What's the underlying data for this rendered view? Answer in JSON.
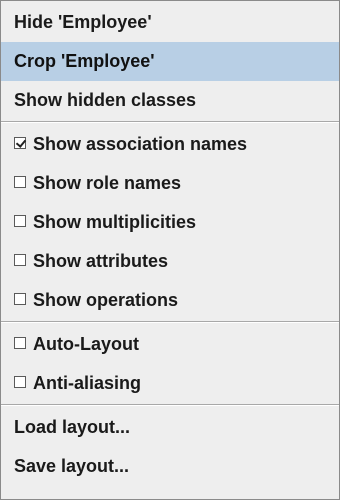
{
  "menu": {
    "group1": [
      {
        "label": "Hide 'Employee'"
      },
      {
        "label": "Crop 'Employee'"
      },
      {
        "label": "Show hidden classes"
      }
    ],
    "group2": [
      {
        "label": "Show association names",
        "checked": true
      },
      {
        "label": "Show role names",
        "checked": false
      },
      {
        "label": "Show multiplicities",
        "checked": false
      },
      {
        "label": "Show attributes",
        "checked": false
      },
      {
        "label": "Show operations",
        "checked": false
      }
    ],
    "group3": [
      {
        "label": "Auto-Layout",
        "checked": false
      },
      {
        "label": "Anti-aliasing",
        "checked": false
      }
    ],
    "group4": [
      {
        "label": "Load layout..."
      },
      {
        "label": "Save layout..."
      }
    ]
  },
  "colors": {
    "menu_bg": "#eeeeee",
    "selected_bg": "#b8cfe5"
  }
}
